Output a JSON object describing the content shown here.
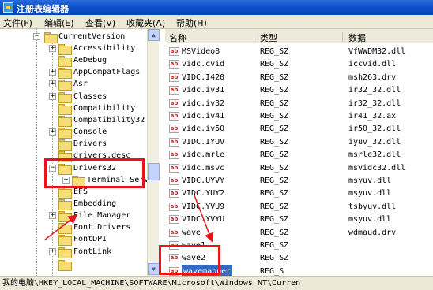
{
  "window": {
    "title": "注册表编辑器"
  },
  "menu": [
    "文件(F)",
    "编辑(E)",
    "查看(V)",
    "收藏夹(A)",
    "帮助(H)"
  ],
  "tree": {
    "parent": "CurrentVersion",
    "items": [
      {
        "label": "Accessibility",
        "expander": "+"
      },
      {
        "label": "AeDebug",
        "expander": ""
      },
      {
        "label": "AppCompatFlags",
        "expander": "+"
      },
      {
        "label": "Asr",
        "expander": "+"
      },
      {
        "label": "Classes",
        "expander": "+"
      },
      {
        "label": "Compatibility",
        "expander": ""
      },
      {
        "label": "Compatibility32",
        "expander": ""
      },
      {
        "label": "Console",
        "expander": "+"
      },
      {
        "label": "Drivers",
        "expander": ""
      },
      {
        "label": "drivers.desc",
        "expander": ""
      },
      {
        "label": "Drivers32",
        "expander": "−"
      },
      {
        "label": "Terminal Serv",
        "expander": "+"
      },
      {
        "label": "EFS",
        "expander": ""
      },
      {
        "label": "Embedding",
        "expander": ""
      },
      {
        "label": "File Manager",
        "expander": "+"
      },
      {
        "label": "Font Drivers",
        "expander": ""
      },
      {
        "label": "FontDPI",
        "expander": ""
      },
      {
        "label": "FontLink",
        "expander": "+"
      }
    ]
  },
  "list": {
    "columns": [
      "名称",
      "类型",
      "数据"
    ],
    "rows": [
      {
        "name": "MSVideo8",
        "type": "REG_SZ",
        "data": "VfWWDM32.dll"
      },
      {
        "name": "vidc.cvid",
        "type": "REG_SZ",
        "data": "iccvid.dll"
      },
      {
        "name": "VIDC.I420",
        "type": "REG_SZ",
        "data": "msh263.drv"
      },
      {
        "name": "vidc.iv31",
        "type": "REG_SZ",
        "data": "ir32_32.dll"
      },
      {
        "name": "vidc.iv32",
        "type": "REG_SZ",
        "data": "ir32_32.dll"
      },
      {
        "name": "vidc.iv41",
        "type": "REG_SZ",
        "data": "ir41_32.ax"
      },
      {
        "name": "vidc.iv50",
        "type": "REG_SZ",
        "data": "ir50_32.dll"
      },
      {
        "name": "VIDC.IYUV",
        "type": "REG_SZ",
        "data": "iyuv_32.dll"
      },
      {
        "name": "vidc.mrle",
        "type": "REG_SZ",
        "data": "msrle32.dll"
      },
      {
        "name": "vidc.msvc",
        "type": "REG_SZ",
        "data": "msvidc32.dll"
      },
      {
        "name": "VIDC.UYVY",
        "type": "REG_SZ",
        "data": "msyuv.dll"
      },
      {
        "name": "VIDC.YUY2",
        "type": "REG_SZ",
        "data": "msyuv.dll"
      },
      {
        "name": "VIDC.YVU9",
        "type": "REG_SZ",
        "data": "tsbyuv.dll"
      },
      {
        "name": "VIDC.YVYU",
        "type": "REG_SZ",
        "data": "msyuv.dll"
      },
      {
        "name": "wave",
        "type": "REG_SZ",
        "data": "wdmaud.drv"
      },
      {
        "name": "wave1",
        "type": "REG_SZ",
        "data": ""
      },
      {
        "name": "wave2",
        "type": "REG_SZ",
        "data": ""
      },
      {
        "name": "wavemapper",
        "type": "REG_S",
        "data": ""
      }
    ]
  },
  "status": {
    "path": "我的电脑\\HKEY_LOCAL_MACHINE\\SOFTWARE\\Microsoft\\Windows NT\\Curren"
  },
  "colors": {
    "highlight": "#e8141a",
    "selection": "#316ac5",
    "titlebar": "#0a4fc9"
  }
}
